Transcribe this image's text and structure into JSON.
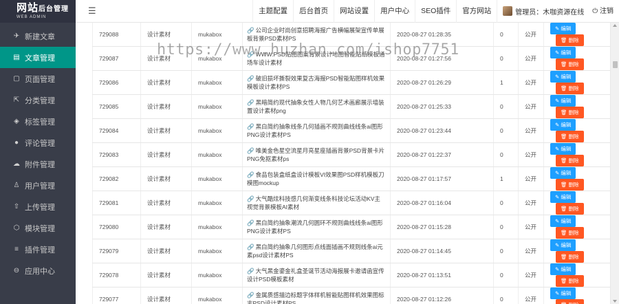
{
  "logo": {
    "main": "网站",
    "small": "后台管理",
    "sub": "WEB ADMIN"
  },
  "header": {
    "menu_toggle_icon": "menu-fold-icon",
    "links": [
      "主题配置",
      "后台首页",
      "网站设置",
      "用户中心",
      "SEO插件",
      "官方网站"
    ],
    "user_label": "管理员：木咖资源在线",
    "logout": "注销"
  },
  "sidebar": {
    "items": [
      {
        "icon": "send-icon",
        "glyph": "✈",
        "label": "新建文章"
      },
      {
        "icon": "file-icon",
        "glyph": "▤",
        "label": "文章管理"
      },
      {
        "icon": "page-icon",
        "glyph": "▢",
        "label": "页面管理"
      },
      {
        "icon": "share-icon",
        "glyph": "⇱",
        "label": "分类管理"
      },
      {
        "icon": "tag-icon",
        "glyph": "◈",
        "label": "标签管理"
      },
      {
        "icon": "comment-icon",
        "glyph": "●",
        "label": "评论管理"
      },
      {
        "icon": "attachment-icon",
        "glyph": "☁",
        "label": "附件管理"
      },
      {
        "icon": "user-icon",
        "glyph": "♙",
        "label": "用户管理"
      },
      {
        "icon": "upload-icon",
        "glyph": "⇧",
        "label": "上传管理"
      },
      {
        "icon": "module-icon",
        "glyph": "⬡",
        "label": "模块管理"
      },
      {
        "icon": "plugin-icon",
        "glyph": "≡",
        "label": "插件管理"
      },
      {
        "icon": "app-center-icon",
        "glyph": "⊖",
        "label": "应用中心"
      }
    ],
    "active_index": 1
  },
  "table": {
    "rows": [
      {
        "id": "729088",
        "category": "设计素材",
        "author": "mukabox",
        "title": "公司企业时尚创意招聘海报广告横幅展架宣传单展板背景PSD素材PS",
        "date": "2020-08-27 01:28:35",
        "count": "0",
        "status": "公开"
      },
      {
        "id": "729087",
        "category": "设计素材",
        "author": "mukabox",
        "title": "WWW.PSD贴图图案背景设计地图智能贴纸模板通场车设计素材",
        "date": "2020-08-27 01:27:56",
        "count": "0",
        "status": "公开"
      },
      {
        "id": "729086",
        "category": "设计素材",
        "author": "mukabox",
        "title": "破旧损坏撕裂效果复古海报PSD智能贴图样机效果模板设计素材PS",
        "date": "2020-08-27 01:26:29",
        "count": "1",
        "status": "公开"
      },
      {
        "id": "729085",
        "category": "设计素材",
        "author": "mukabox",
        "title": "黑暗简约现代抽象女性人物几何艺术画廊展示墙装置设计素材png",
        "date": "2020-08-27 01:25:33",
        "count": "0",
        "status": "公开"
      },
      {
        "id": "729084",
        "category": "设计素材",
        "author": "mukabox",
        "title": "黑白简约抽象线条几何插画不规则曲线线条ai图形PNG设计素材PS",
        "date": "2020-08-27 01:23:44",
        "count": "0",
        "status": "公开"
      },
      {
        "id": "729083",
        "category": "设计素材",
        "author": "mukabox",
        "title": "唯美金色星空流星月亮星座插画背景PSD背景卡片PNG免抠素材ps",
        "date": "2020-08-27 01:22:37",
        "count": "0",
        "status": "公开"
      },
      {
        "id": "729082",
        "category": "设计素材",
        "author": "mukabox",
        "title": "食品包装盒纸盒设计模板VI效果图PSD样机模板刀模图mockup",
        "date": "2020-08-27 01:17:57",
        "count": "1",
        "status": "公开"
      },
      {
        "id": "729081",
        "category": "设计素材",
        "author": "mukabox",
        "title": "大气酷炫科技感几何渐变线条科技论坛活动KV主视觉背景模板AI素材",
        "date": "2020-08-27 01:16:04",
        "count": "0",
        "status": "公开"
      },
      {
        "id": "729080",
        "category": "设计素材",
        "author": "mukabox",
        "title": "黑白简约抽象潮流几何圆环不规则曲线线条ai图形PNG设计素材PS",
        "date": "2020-08-27 01:15:28",
        "count": "0",
        "status": "公开"
      },
      {
        "id": "729079",
        "category": "设计素材",
        "author": "mukabox",
        "title": "黑白简约抽象几何图形点线面插画不规则线条ai元素psd设计素材PS",
        "date": "2020-08-27 01:14:45",
        "count": "0",
        "status": "公开"
      },
      {
        "id": "729078",
        "category": "设计素材",
        "author": "mukabox",
        "title": "大气黑金鎏金礼盒圣诞节活动海报展卡邀请函宣传设计PSD模板素材",
        "date": "2020-08-27 01:13:51",
        "count": "0",
        "status": "公开"
      },
      {
        "id": "729077",
        "category": "设计素材",
        "author": "mukabox",
        "title": "金属质感描边标题字体样机智能贴图样机效果图标志PSD设计素材PS",
        "date": "2020-08-27 01:12:26",
        "count": "0",
        "status": "公开"
      }
    ],
    "edit_label": "编辑",
    "delete_label": "删除",
    "edit_icon": "pencil-icon",
    "delete_icon": "trash-icon"
  },
  "watermark": "https://www.huzhan.com/ishop7751",
  "colors": {
    "sidebar": "#393d49",
    "active": "#009688",
    "edit": "#1e9fff",
    "delete": "#ff5722"
  }
}
